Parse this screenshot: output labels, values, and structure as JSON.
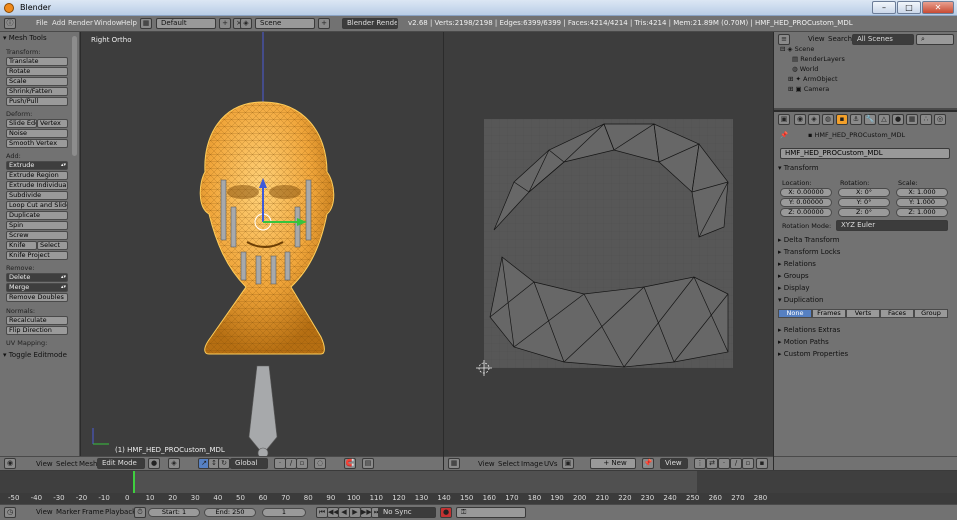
{
  "window": {
    "title": "Blender",
    "buttons": [
      "–",
      "□",
      "✕"
    ]
  },
  "info_header": {
    "menus": [
      "File",
      "Add",
      "Render",
      "Window",
      "Help"
    ],
    "screen_layout": "Default",
    "scene": "Scene",
    "engine": "Blender Render",
    "stats": "v2.68 | Verts:2198/2198 | Edges:6399/6399 | Faces:4214/4214 | Tris:4214 | Mem:21.89M (0.70M) | HMF_HED_PROCustom_MDL"
  },
  "toolshelf": {
    "title": "Mesh Tools",
    "transform_label": "Transform:",
    "transform": [
      "Translate",
      "Rotate",
      "Scale",
      "Shrink/Fatten",
      "Push/Pull"
    ],
    "deform_label": "Deform:",
    "slide_edge": "Slide Edge",
    "vertex": "Vertex",
    "noise": "Noise",
    "smooth_vertex": "Smooth Vertex",
    "add_label": "Add:",
    "extrude": "Extrude",
    "add": [
      "Extrude Region",
      "Extrude Individual",
      "Subdivide",
      "Loop Cut and Slide",
      "Duplicate",
      "Spin",
      "Screw"
    ],
    "knife": "Knife",
    "select": "Select",
    "knife_project": "Knife Project",
    "remove_label": "Remove:",
    "delete": "Delete",
    "merge": "Merge",
    "remove_doubles": "Remove Doubles",
    "normals_label": "Normals:",
    "recalculate": "Recalculate",
    "flip_direction": "Flip Direction",
    "uv_label": "UV Mapping:",
    "toggle_editmode": "Toggle Editmode"
  },
  "viewport": {
    "view_name": "Right Ortho",
    "object_label": "(1) HMF_HED_PROCustom_MDL"
  },
  "outliner": {
    "menus": [
      "View",
      "Search"
    ],
    "filter": "All Scenes",
    "items": [
      "Scene",
      "RenderLayers",
      "World",
      "ArmObject",
      "Camera"
    ]
  },
  "properties": {
    "object_path": "HMF_HED_PROCustom_MDL",
    "object_name": "HMF_HED_PROCustom_MDL",
    "transform_title": "Transform",
    "location_label": "Location:",
    "rotation_label": "Rotation:",
    "scale_label": "Scale:",
    "location": [
      "X: 0.00000",
      "Y: 0.00000",
      "Z: 0.00000"
    ],
    "rotation": [
      "X: 0°",
      "Y: 0°",
      "Z: 0°"
    ],
    "scale": [
      "X: 1.000",
      "Y: 1.000",
      "Z: 1.000"
    ],
    "rotation_mode_label": "Rotation Mode:",
    "rotation_mode": "XYZ Euler",
    "panels_a": [
      "Delta Transform",
      "Transform Locks",
      "Relations",
      "Groups",
      "Display"
    ],
    "duplication_title": "Duplication",
    "duplication": [
      "None",
      "Frames",
      "Verts",
      "Faces",
      "Group"
    ],
    "panels_b": [
      "Relations Extras",
      "Motion Paths",
      "Custom Properties"
    ]
  },
  "view3d_header": {
    "menus": [
      "View",
      "Select",
      "Mesh"
    ],
    "mode": "Edit Mode",
    "orientation": "Global"
  },
  "uv_header": {
    "menus": [
      "View",
      "Select",
      "Image",
      "UVs"
    ],
    "new_label": "New",
    "view_label": "View"
  },
  "timeline": {
    "ticks": [
      "-50",
      "-40",
      "-30",
      "-20",
      "-10",
      "0",
      "10",
      "20",
      "30",
      "40",
      "50",
      "60",
      "70",
      "80",
      "90",
      "100",
      "110",
      "120",
      "130",
      "140",
      "150",
      "160",
      "170",
      "180",
      "190",
      "200",
      "210",
      "220",
      "230",
      "240",
      "250",
      "260",
      "270",
      "280"
    ],
    "current_frame": 0,
    "menus": [
      "View",
      "Marker",
      "Frame",
      "Playback"
    ],
    "start": "Start: 1",
    "end": "End: 250",
    "frame": "1",
    "sync": "No Sync"
  },
  "colors": {
    "accent_orange": "#f39c12",
    "selection_blue": "#5680c2",
    "panel_gray": "#727272"
  }
}
